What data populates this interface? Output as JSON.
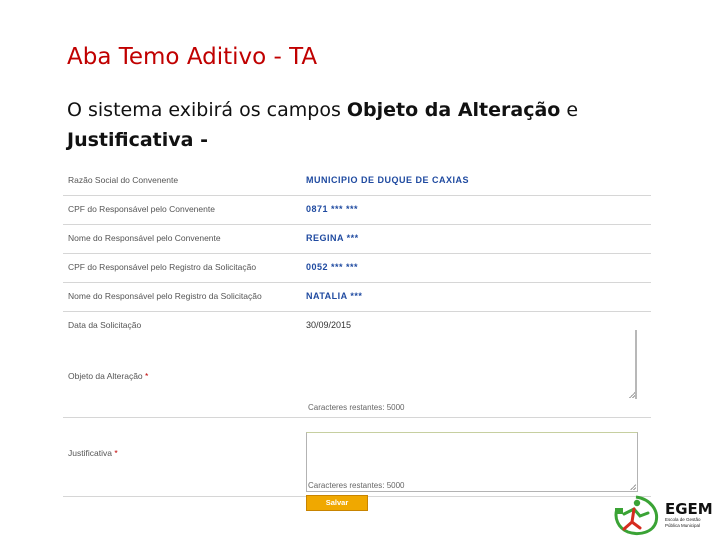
{
  "slide": {
    "title": "Aba Temo Aditivo - TA",
    "body_prefix": "O sistema exibirá  os campos ",
    "body_bold_1": "Objeto da Alteração",
    "body_mid": " e ",
    "body_bold_2": "Justificativa",
    "body_suffix": " -"
  },
  "form": {
    "rows": [
      {
        "label": "Razão Social do Convenente",
        "value": "MUNICIPIO DE DUQUE DE CAXIAS"
      },
      {
        "label": "CPF do Responsável pelo Convenente",
        "value": "0871 *** ***"
      },
      {
        "label": "Nome do Responsável pelo Convenente",
        "value": "REGINA ***"
      },
      {
        "label": "CPF do Responsável pelo Registro da Solicitação",
        "value": "0052 *** ***"
      },
      {
        "label": "Nome do Responsável pelo Registro da Solicitação",
        "value": "NATALIA ***"
      },
      {
        "label": "Data da Solicitação",
        "value": "30/09/2015"
      }
    ],
    "objeto": {
      "label": "Objeto da Alteração",
      "required_mark": "*",
      "value": "",
      "counter": "Caracteres restantes: 5000"
    },
    "justificativa": {
      "label": "Justificativa",
      "required_mark": "*",
      "value": "",
      "counter": "Caracteres restantes: 5000"
    },
    "save_label": "Salvar"
  },
  "logo": {
    "name": "EGEM",
    "subtitle": "Escola de Gestão Pública Municipal"
  },
  "colors": {
    "title": "#c00000",
    "value_text": "#1f4aa0",
    "save_button": "#f0a800",
    "logo_green": "#3aa335",
    "logo_red": "#d62b1f"
  }
}
